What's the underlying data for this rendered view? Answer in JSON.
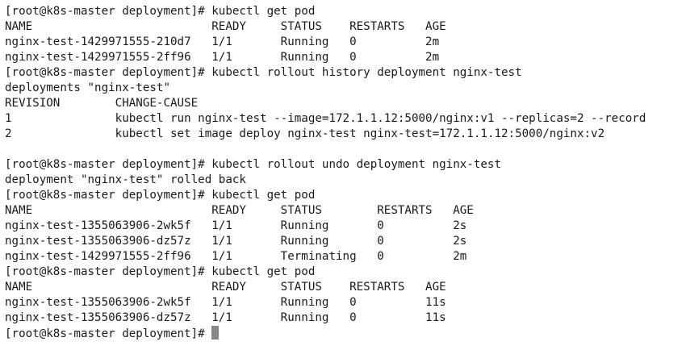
{
  "terminal": {
    "background": "#ffffff",
    "foreground": "#1a1a1a",
    "cursor_color": "#888888",
    "lines": [
      "[root@k8s-master deployment]# kubectl get pod",
      "NAME                          READY     STATUS    RESTARTS   AGE",
      "nginx-test-1429971555-210d7   1/1       Running   0          2m",
      "nginx-test-1429971555-2ff96   1/1       Running   0          2m",
      "[root@k8s-master deployment]# kubectl rollout history deployment nginx-test",
      "deployments \"nginx-test\"",
      "REVISION        CHANGE-CAUSE",
      "1               kubectl run nginx-test --image=172.1.1.12:5000/nginx:v1 --replicas=2 --record",
      "2               kubectl set image deploy nginx-test nginx-test=172.1.1.12:5000/nginx:v2",
      "",
      "[root@k8s-master deployment]# kubectl rollout undo deployment nginx-test",
      "deployment \"nginx-test\" rolled back",
      "[root@k8s-master deployment]# kubectl get pod",
      "NAME                          READY     STATUS        RESTARTS   AGE",
      "nginx-test-1355063906-2wk5f   1/1       Running       0          2s",
      "nginx-test-1355063906-dz57z   1/1       Running       0          2s",
      "nginx-test-1429971555-2ff96   1/1       Terminating   0          2m",
      "[root@k8s-master deployment]# kubectl get pod",
      "NAME                          READY     STATUS    RESTARTS   AGE",
      "nginx-test-1355063906-2wk5f   1/1       Running   0          11s",
      "nginx-test-1355063906-dz57z   1/1       Running   0          11s",
      "[root@k8s-master deployment]#"
    ]
  }
}
